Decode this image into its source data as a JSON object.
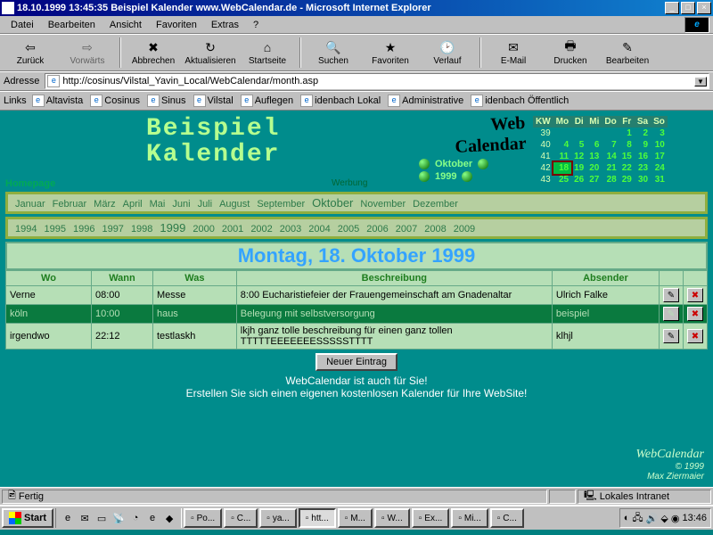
{
  "window": {
    "title": "18.10.1999 13:45:35 Beispiel Kalender www.WebCalendar.de - Microsoft Internet Explorer"
  },
  "menubar": [
    "Datei",
    "Bearbeiten",
    "Ansicht",
    "Favoriten",
    "Extras",
    "?"
  ],
  "toolbar": {
    "back": "Zurück",
    "forward": "Vorwärts",
    "stop": "Abbrechen",
    "refresh": "Aktualisieren",
    "home": "Startseite",
    "search": "Suchen",
    "favorites": "Favoriten",
    "history": "Verlauf",
    "mail": "E-Mail",
    "print": "Drucken",
    "edit": "Bearbeiten"
  },
  "address": {
    "label": "Adresse",
    "url": "http://cosinus/Vilstal_Yavin_Local/WebCalendar/month.asp"
  },
  "links": {
    "label": "Links",
    "items": [
      "Altavista",
      "Cosinus",
      "Sinus",
      "Vilstal",
      "Auflegen",
      "idenbach Lokal",
      "Administrative",
      "idenbach Öffentlich"
    ]
  },
  "app": {
    "title_line1": "Beispiel",
    "title_line2": "Kalender",
    "homepage": "Homepage",
    "werbung": "Werbung",
    "logo_line1": "Web",
    "logo_line2": "Calendar",
    "month_nav": "Oktober",
    "year_nav": "1999"
  },
  "mini_cal": {
    "headers": [
      "KW",
      "Mo",
      "Di",
      "Mi",
      "Do",
      "Fr",
      "Sa",
      "So"
    ],
    "rows": [
      {
        "kw": "39",
        "days": [
          "",
          "",
          "",
          "",
          "1",
          "2",
          "3"
        ]
      },
      {
        "kw": "40",
        "days": [
          "4",
          "5",
          "6",
          "7",
          "8",
          "9",
          "10"
        ]
      },
      {
        "kw": "41",
        "days": [
          "11",
          "12",
          "13",
          "14",
          "15",
          "16",
          "17"
        ]
      },
      {
        "kw": "42",
        "days": [
          "18",
          "19",
          "20",
          "21",
          "22",
          "23",
          "24"
        ]
      },
      {
        "kw": "43",
        "days": [
          "25",
          "26",
          "27",
          "28",
          "29",
          "30",
          "31"
        ]
      }
    ],
    "today": "18"
  },
  "months": [
    "Januar",
    "Februar",
    "März",
    "April",
    "Mai",
    "Juni",
    "Juli",
    "August",
    "September",
    "Oktober",
    "November",
    "Dezember"
  ],
  "current_month": "Oktober",
  "years": [
    "1994",
    "1995",
    "1996",
    "1997",
    "1998",
    "1999",
    "2000",
    "2001",
    "2002",
    "2003",
    "2004",
    "2005",
    "2006",
    "2007",
    "2008",
    "2009"
  ],
  "current_year": "1999",
  "day_header": "Montag, 18. Oktober 1999",
  "event_headers": {
    "wo": "Wo",
    "wann": "Wann",
    "was": "Was",
    "beschreibung": "Beschreibung",
    "absender": "Absender"
  },
  "events": [
    {
      "wo": "Verne",
      "wann": "08:00",
      "was": "Messe",
      "beschreibung": "8:00 Eucharistiefeier der Frauengemeinschaft am Gnadenaltar",
      "absender": "Ulrich Falke"
    },
    {
      "wo": "köln",
      "wann": "10:00",
      "was": "haus",
      "beschreibung": "Belegung mit selbstversorgung",
      "absender": "beispiel"
    },
    {
      "wo": "irgendwo",
      "wann": "22:12",
      "was": "testlaskh",
      "beschreibung": "lkjh ganz tolle beschreibung für einen ganz tollen TTTTTEEEEEEESSSSSTTTT",
      "absender": "klhjl"
    }
  ],
  "new_entry": "Neuer Eintrag",
  "footer": {
    "l1": "WebCalendar ist auch für Sie!",
    "l2": "Erstellen Sie sich einen eigenen kostenlosen Kalender für Ihre WebSite!"
  },
  "copyright": {
    "name": "WebCalendar",
    "year": "© 1999",
    "author": "Max Ziermaier"
  },
  "statusbar": {
    "status": "Fertig",
    "zone": "Lokales Intranet"
  },
  "taskbar": {
    "start": "Start",
    "tasks": [
      {
        "label": "Po..."
      },
      {
        "label": "C..."
      },
      {
        "label": "ya..."
      },
      {
        "label": "htt..."
      },
      {
        "label": "M..."
      },
      {
        "label": "W..."
      },
      {
        "label": "Ex..."
      },
      {
        "label": "Mi..."
      },
      {
        "label": "C..."
      }
    ],
    "clock": "13:46"
  }
}
